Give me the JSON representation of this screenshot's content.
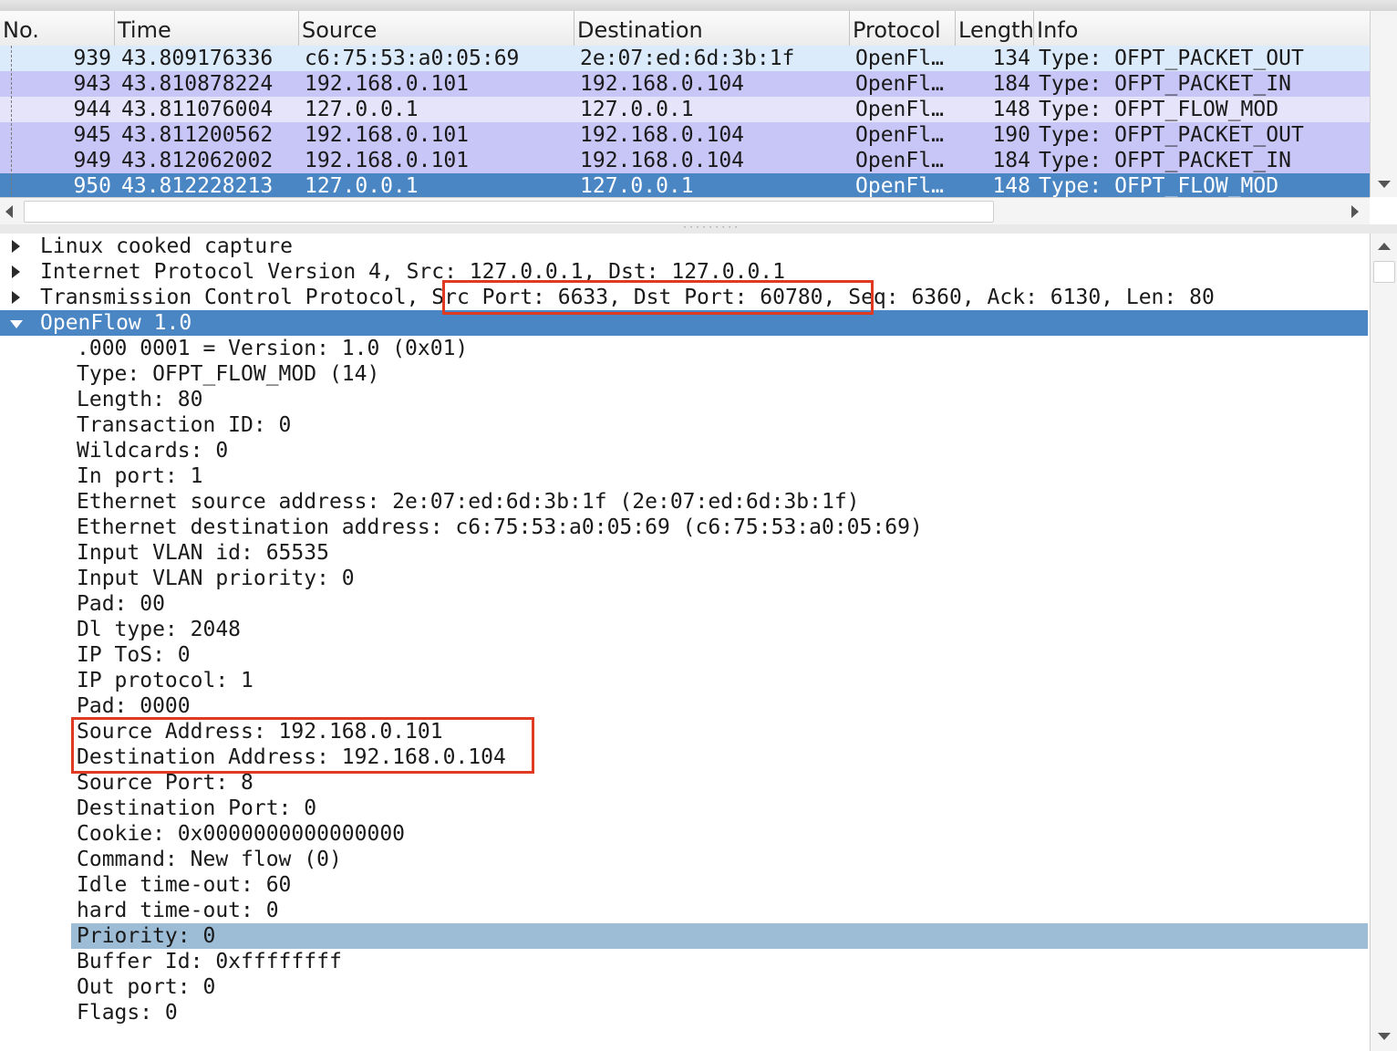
{
  "packet_list": {
    "columns": [
      "No.",
      "Time",
      "Source",
      "Destination",
      "Protocol",
      "Length",
      "Info"
    ],
    "rows": [
      {
        "no": "939",
        "time": "43.809176336",
        "source": "c6:75:53:a0:05:69",
        "destination": "2e:07:ed:6d:3b:1f",
        "protocol": "OpenFl…",
        "length": "134",
        "info": "Type: OFPT_PACKET_OUT"
      },
      {
        "no": "943",
        "time": "43.810878224",
        "source": "192.168.0.101",
        "destination": "192.168.0.104",
        "protocol": "OpenFl…",
        "length": "184",
        "info": "Type: OFPT_PACKET_IN"
      },
      {
        "no": "944",
        "time": "43.811076004",
        "source": "127.0.0.1",
        "destination": "127.0.0.1",
        "protocol": "OpenFl…",
        "length": "148",
        "info": "Type: OFPT_FLOW_MOD"
      },
      {
        "no": "945",
        "time": "43.811200562",
        "source": "192.168.0.101",
        "destination": "192.168.0.104",
        "protocol": "OpenFl…",
        "length": "190",
        "info": "Type: OFPT_PACKET_OUT"
      },
      {
        "no": "949",
        "time": "43.812062002",
        "source": "192.168.0.101",
        "destination": "192.168.0.104",
        "protocol": "OpenFl…",
        "length": "184",
        "info": "Type: OFPT_PACKET_IN"
      },
      {
        "no": "950",
        "time": "43.812228213",
        "source": "127.0.0.1",
        "destination": "127.0.0.1",
        "protocol": "OpenFl…",
        "length": "148",
        "info": "Type: OFPT_FLOW_MOD"
      }
    ],
    "row_colors": [
      "#dcebfb",
      "#c8c6f6",
      "#e6e4fb",
      "#c8c6f6",
      "#c8c6f6",
      "#4a86c3"
    ],
    "selected_row_index": 5
  },
  "details": {
    "layers": [
      {
        "label": "Linux cooked capture",
        "expanded": false
      },
      {
        "label": "Internet Protocol Version 4, Src: 127.0.0.1, Dst: 127.0.0.1",
        "expanded": false
      },
      {
        "label_before": "Transmission Control Protocol, ",
        "label_highlight": "Src Port: 6633, Dst Port: 60780,",
        "label_after": " Seq: 6360, Ack: 6130, Len: 80",
        "expanded": false
      },
      {
        "label": "OpenFlow 1.0",
        "expanded": true
      }
    ],
    "openflow_fields": [
      ".000 0001 = Version: 1.0 (0x01)",
      "Type: OFPT_FLOW_MOD (14)",
      "Length: 80",
      "Transaction ID: 0",
      "Wildcards: 0",
      "In port: 1",
      "Ethernet source address: 2e:07:ed:6d:3b:1f (2e:07:ed:6d:3b:1f)",
      "Ethernet destination address: c6:75:53:a0:05:69 (c6:75:53:a0:05:69)",
      "Input VLAN id: 65535",
      "Input VLAN priority: 0",
      "Pad: 00",
      "Dl type: 2048",
      "IP ToS: 0",
      "IP protocol: 1",
      "Pad: 0000",
      "Source Address: 192.168.0.101",
      "Destination Address: 192.168.0.104",
      "Source Port: 8",
      "Destination Port: 0",
      "Cookie: 0x0000000000000000",
      "Command: New flow (0)",
      "Idle time-out: 60",
      "hard time-out: 0",
      "Priority: 0",
      "Buffer Id: 0xffffffff",
      "Out port: 0",
      "Flags: 0"
    ],
    "highlighted_field_index": 23
  },
  "colors": {
    "selected_bg": "#4a86c3",
    "selected_text": "#ffffff",
    "field_highlight_bg": "#9dbcd6",
    "annotation_red": "#e03a22"
  },
  "icons": {
    "collapsed_layer": "triangle-right-icon",
    "expanded_layer": "triangle-down-icon",
    "scroll_up": "arrow-up-icon",
    "scroll_down": "arrow-down-icon",
    "scroll_left": "arrow-left-icon",
    "scroll_right": "arrow-right-icon"
  }
}
